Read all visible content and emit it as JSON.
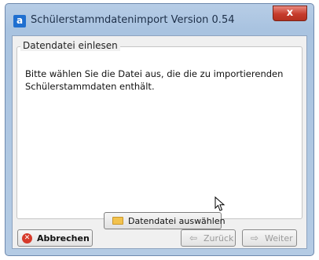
{
  "window": {
    "title": "Schülerstammdatenimport  Version 0.54",
    "app_icon": "a",
    "close_label": "x"
  },
  "group": {
    "title": "Datendatei einlesen",
    "instruction": "Bitte wählen Sie die Datei aus, die die zu importierenden Schülerstammdaten enthält."
  },
  "buttons": {
    "select_file": "Datendatei auswählen",
    "cancel": "Abbrechen",
    "back": "Zurück",
    "next": "Weiter"
  },
  "icons": {
    "select_file": "folder-icon",
    "cancel": "cancel-icon",
    "back": "arrow-left-icon",
    "next": "arrow-right-icon"
  }
}
